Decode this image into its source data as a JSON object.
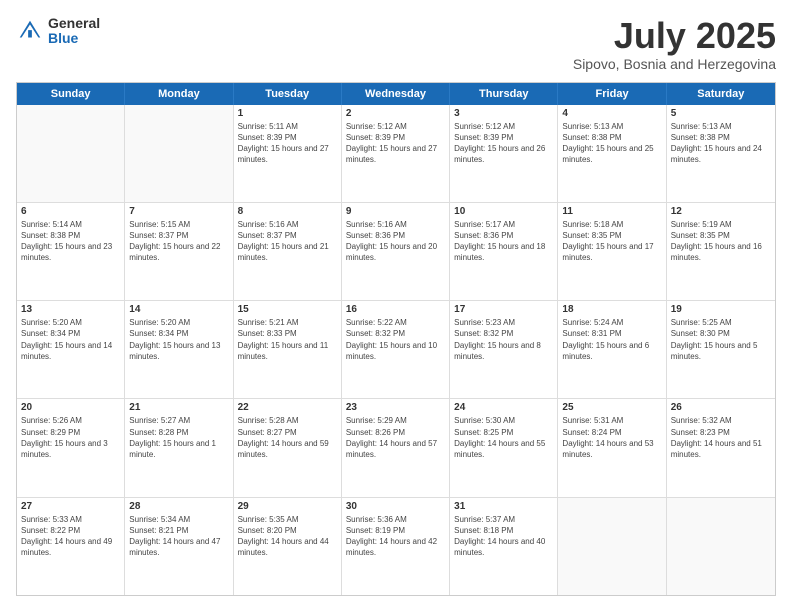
{
  "logo": {
    "general": "General",
    "blue": "Blue"
  },
  "title": "July 2025",
  "location": "Sipovo, Bosnia and Herzegovina",
  "weekdays": [
    "Sunday",
    "Monday",
    "Tuesday",
    "Wednesday",
    "Thursday",
    "Friday",
    "Saturday"
  ],
  "weeks": [
    [
      {
        "day": "",
        "sunrise": "",
        "sunset": "",
        "daylight": ""
      },
      {
        "day": "",
        "sunrise": "",
        "sunset": "",
        "daylight": ""
      },
      {
        "day": "1",
        "sunrise": "Sunrise: 5:11 AM",
        "sunset": "Sunset: 8:39 PM",
        "daylight": "Daylight: 15 hours and 27 minutes."
      },
      {
        "day": "2",
        "sunrise": "Sunrise: 5:12 AM",
        "sunset": "Sunset: 8:39 PM",
        "daylight": "Daylight: 15 hours and 27 minutes."
      },
      {
        "day": "3",
        "sunrise": "Sunrise: 5:12 AM",
        "sunset": "Sunset: 8:39 PM",
        "daylight": "Daylight: 15 hours and 26 minutes."
      },
      {
        "day": "4",
        "sunrise": "Sunrise: 5:13 AM",
        "sunset": "Sunset: 8:38 PM",
        "daylight": "Daylight: 15 hours and 25 minutes."
      },
      {
        "day": "5",
        "sunrise": "Sunrise: 5:13 AM",
        "sunset": "Sunset: 8:38 PM",
        "daylight": "Daylight: 15 hours and 24 minutes."
      }
    ],
    [
      {
        "day": "6",
        "sunrise": "Sunrise: 5:14 AM",
        "sunset": "Sunset: 8:38 PM",
        "daylight": "Daylight: 15 hours and 23 minutes."
      },
      {
        "day": "7",
        "sunrise": "Sunrise: 5:15 AM",
        "sunset": "Sunset: 8:37 PM",
        "daylight": "Daylight: 15 hours and 22 minutes."
      },
      {
        "day": "8",
        "sunrise": "Sunrise: 5:16 AM",
        "sunset": "Sunset: 8:37 PM",
        "daylight": "Daylight: 15 hours and 21 minutes."
      },
      {
        "day": "9",
        "sunrise": "Sunrise: 5:16 AM",
        "sunset": "Sunset: 8:36 PM",
        "daylight": "Daylight: 15 hours and 20 minutes."
      },
      {
        "day": "10",
        "sunrise": "Sunrise: 5:17 AM",
        "sunset": "Sunset: 8:36 PM",
        "daylight": "Daylight: 15 hours and 18 minutes."
      },
      {
        "day": "11",
        "sunrise": "Sunrise: 5:18 AM",
        "sunset": "Sunset: 8:35 PM",
        "daylight": "Daylight: 15 hours and 17 minutes."
      },
      {
        "day": "12",
        "sunrise": "Sunrise: 5:19 AM",
        "sunset": "Sunset: 8:35 PM",
        "daylight": "Daylight: 15 hours and 16 minutes."
      }
    ],
    [
      {
        "day": "13",
        "sunrise": "Sunrise: 5:20 AM",
        "sunset": "Sunset: 8:34 PM",
        "daylight": "Daylight: 15 hours and 14 minutes."
      },
      {
        "day": "14",
        "sunrise": "Sunrise: 5:20 AM",
        "sunset": "Sunset: 8:34 PM",
        "daylight": "Daylight: 15 hours and 13 minutes."
      },
      {
        "day": "15",
        "sunrise": "Sunrise: 5:21 AM",
        "sunset": "Sunset: 8:33 PM",
        "daylight": "Daylight: 15 hours and 11 minutes."
      },
      {
        "day": "16",
        "sunrise": "Sunrise: 5:22 AM",
        "sunset": "Sunset: 8:32 PM",
        "daylight": "Daylight: 15 hours and 10 minutes."
      },
      {
        "day": "17",
        "sunrise": "Sunrise: 5:23 AM",
        "sunset": "Sunset: 8:32 PM",
        "daylight": "Daylight: 15 hours and 8 minutes."
      },
      {
        "day": "18",
        "sunrise": "Sunrise: 5:24 AM",
        "sunset": "Sunset: 8:31 PM",
        "daylight": "Daylight: 15 hours and 6 minutes."
      },
      {
        "day": "19",
        "sunrise": "Sunrise: 5:25 AM",
        "sunset": "Sunset: 8:30 PM",
        "daylight": "Daylight: 15 hours and 5 minutes."
      }
    ],
    [
      {
        "day": "20",
        "sunrise": "Sunrise: 5:26 AM",
        "sunset": "Sunset: 8:29 PM",
        "daylight": "Daylight: 15 hours and 3 minutes."
      },
      {
        "day": "21",
        "sunrise": "Sunrise: 5:27 AM",
        "sunset": "Sunset: 8:28 PM",
        "daylight": "Daylight: 15 hours and 1 minute."
      },
      {
        "day": "22",
        "sunrise": "Sunrise: 5:28 AM",
        "sunset": "Sunset: 8:27 PM",
        "daylight": "Daylight: 14 hours and 59 minutes."
      },
      {
        "day": "23",
        "sunrise": "Sunrise: 5:29 AM",
        "sunset": "Sunset: 8:26 PM",
        "daylight": "Daylight: 14 hours and 57 minutes."
      },
      {
        "day": "24",
        "sunrise": "Sunrise: 5:30 AM",
        "sunset": "Sunset: 8:25 PM",
        "daylight": "Daylight: 14 hours and 55 minutes."
      },
      {
        "day": "25",
        "sunrise": "Sunrise: 5:31 AM",
        "sunset": "Sunset: 8:24 PM",
        "daylight": "Daylight: 14 hours and 53 minutes."
      },
      {
        "day": "26",
        "sunrise": "Sunrise: 5:32 AM",
        "sunset": "Sunset: 8:23 PM",
        "daylight": "Daylight: 14 hours and 51 minutes."
      }
    ],
    [
      {
        "day": "27",
        "sunrise": "Sunrise: 5:33 AM",
        "sunset": "Sunset: 8:22 PM",
        "daylight": "Daylight: 14 hours and 49 minutes."
      },
      {
        "day": "28",
        "sunrise": "Sunrise: 5:34 AM",
        "sunset": "Sunset: 8:21 PM",
        "daylight": "Daylight: 14 hours and 47 minutes."
      },
      {
        "day": "29",
        "sunrise": "Sunrise: 5:35 AM",
        "sunset": "Sunset: 8:20 PM",
        "daylight": "Daylight: 14 hours and 44 minutes."
      },
      {
        "day": "30",
        "sunrise": "Sunrise: 5:36 AM",
        "sunset": "Sunset: 8:19 PM",
        "daylight": "Daylight: 14 hours and 42 minutes."
      },
      {
        "day": "31",
        "sunrise": "Sunrise: 5:37 AM",
        "sunset": "Sunset: 8:18 PM",
        "daylight": "Daylight: 14 hours and 40 minutes."
      },
      {
        "day": "",
        "sunrise": "",
        "sunset": "",
        "daylight": ""
      },
      {
        "day": "",
        "sunrise": "",
        "sunset": "",
        "daylight": ""
      }
    ]
  ]
}
